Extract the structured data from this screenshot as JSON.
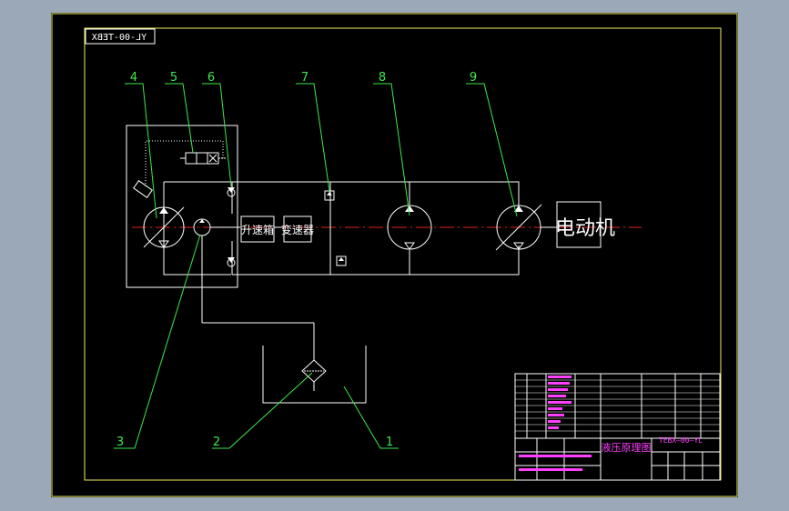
{
  "drawing": {
    "code_box": "YL-00-TEBX",
    "motor_label": "电动机",
    "speedup_box": "升速箱",
    "converter_box": "变速器"
  },
  "callouts": {
    "n1": "1",
    "n2": "2",
    "n3": "3",
    "n4": "4",
    "n5": "5",
    "n6": "6",
    "n7": "7",
    "n8": "8",
    "n9": "9"
  },
  "title_block": {
    "drawing_title": "液压原理图",
    "drawing_code": "TEBX—00—YL"
  },
  "colors": {
    "background": "#000000",
    "frame": "#f0f060",
    "line": "#ffffff",
    "leader": "#3ee84a",
    "center_line": "#e02020",
    "title_grid": "#ffffff",
    "title_text": "#ff40ff"
  }
}
